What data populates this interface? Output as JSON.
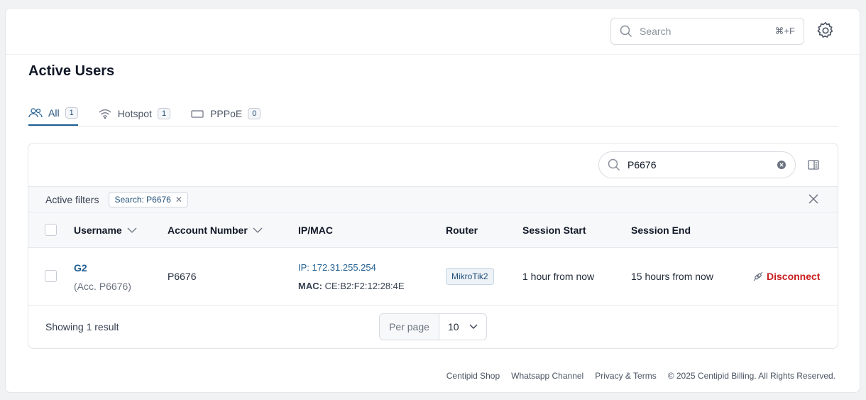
{
  "header": {
    "search_placeholder": "Search",
    "search_shortcut": "⌘+F",
    "settings_icon": "gear-icon"
  },
  "page": {
    "title": "Active Users"
  },
  "tabs": [
    {
      "label": "All",
      "count": "1",
      "icon": "users-icon",
      "active": true
    },
    {
      "label": "Hotspot",
      "count": "1",
      "icon": "wifi-icon",
      "active": false
    },
    {
      "label": "PPPoE",
      "count": "0",
      "icon": "ethernet-icon",
      "active": false
    }
  ],
  "table_search": {
    "value": "P6676"
  },
  "filters": {
    "label": "Active filters",
    "chip": "Search: P6676"
  },
  "columns": [
    "Username",
    "Account Number",
    "IP/MAC",
    "Router",
    "Session Start",
    "Session End"
  ],
  "rows": [
    {
      "username": "G2",
      "account_sub": "(Acc. P6676)",
      "account_number": "P6676",
      "ip": "IP: 172.31.255.254",
      "mac_label": "MAC:",
      "mac_value": "CE:B2:F2:12:28:4E",
      "router": "MikroTik2",
      "session_start": "1 hour from now",
      "session_end": "15 hours from now",
      "action": "Disconnect"
    }
  ],
  "footer": {
    "showing": "Showing 1 result",
    "per_page_label": "Per page",
    "per_page_value": "10"
  },
  "page_footer": {
    "links": [
      "Centipid Shop",
      "Whatsapp Channel",
      "Privacy & Terms"
    ],
    "copyright": "© 2025 Centipid Billing. All Rights Reserved."
  },
  "colors": {
    "accent": "#1f5d8f",
    "danger": "#c81e1e"
  }
}
